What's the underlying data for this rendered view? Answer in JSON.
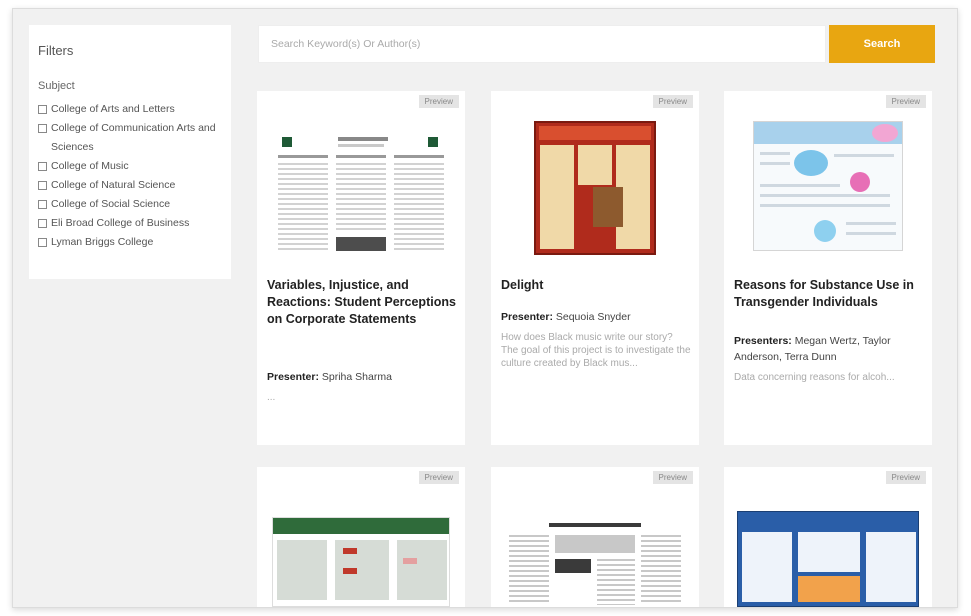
{
  "sidebar": {
    "title": "Filters",
    "subject_label": "Subject",
    "subjects": [
      "College of Arts and Letters",
      "College of Communication Arts and Sciences",
      "College of Music",
      "College of Natural Science",
      "College of Social Science",
      "Eli Broad College of Business",
      "Lyman Briggs College"
    ]
  },
  "search": {
    "placeholder": "Search Keyword(s) Or Author(s)",
    "button_label": "Search"
  },
  "cards": [
    {
      "badge": "Preview",
      "title": "Variables, Injustice, and Reactions: Student Perceptions on Corporate Statements",
      "presenter_label": "Presenter:",
      "presenters": "Spriha Sharma",
      "description": "..."
    },
    {
      "badge": "Preview",
      "title": "Delight",
      "presenter_label": "Presenter:",
      "presenters": "Sequoia Snyder",
      "description": "How does Black music write our story? The goal of this project is to investigate the culture created by Black mus..."
    },
    {
      "badge": "Preview",
      "title": "Reasons for Substance Use in Transgender Individuals",
      "presenter_label": "Presenters:",
      "presenters": "Megan Wertz, Taylor Anderson, Terra Dunn",
      "description": "Data concerning reasons for alcoh..."
    },
    {
      "badge": "Preview"
    },
    {
      "badge": "Preview"
    },
    {
      "badge": "Preview"
    }
  ],
  "colors": {
    "accent": "#e8a611",
    "page_background": "#f1f1f1",
    "card_background": "#ffffff"
  }
}
